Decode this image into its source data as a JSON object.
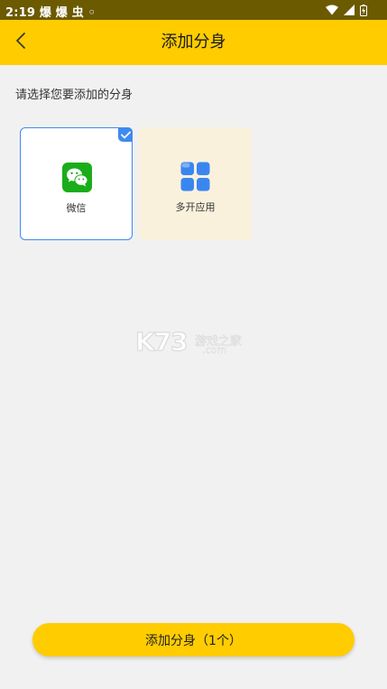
{
  "status_bar": {
    "time_text": "2:19 爆 爆 虫 ◦",
    "icons": [
      "wifi-icon",
      "cell-signal-icon",
      "battery-icon"
    ]
  },
  "header": {
    "title": "添加分身",
    "back_icon": "chevron-left-icon"
  },
  "main": {
    "instruction": "请选择您要添加的分身",
    "apps": [
      {
        "label": "微信",
        "icon": "wechat-icon",
        "selected": true
      },
      {
        "label": "多开应用",
        "icon": "grid-apps-icon",
        "selected": false
      }
    ],
    "watermark": {
      "mark": "K73",
      "site_name": "游戏之家",
      "site_suffix": ".com"
    }
  },
  "footer": {
    "confirm_label": "添加分身（1个）"
  },
  "colors": {
    "accent_yellow": "#ffcc00",
    "status_bar_bg": "#6b5a00",
    "selection_blue": "#3d8bef",
    "wechat_green": "#1aad19",
    "multi_card_bg": "#faf1dd",
    "background": "#f1f1f1"
  }
}
